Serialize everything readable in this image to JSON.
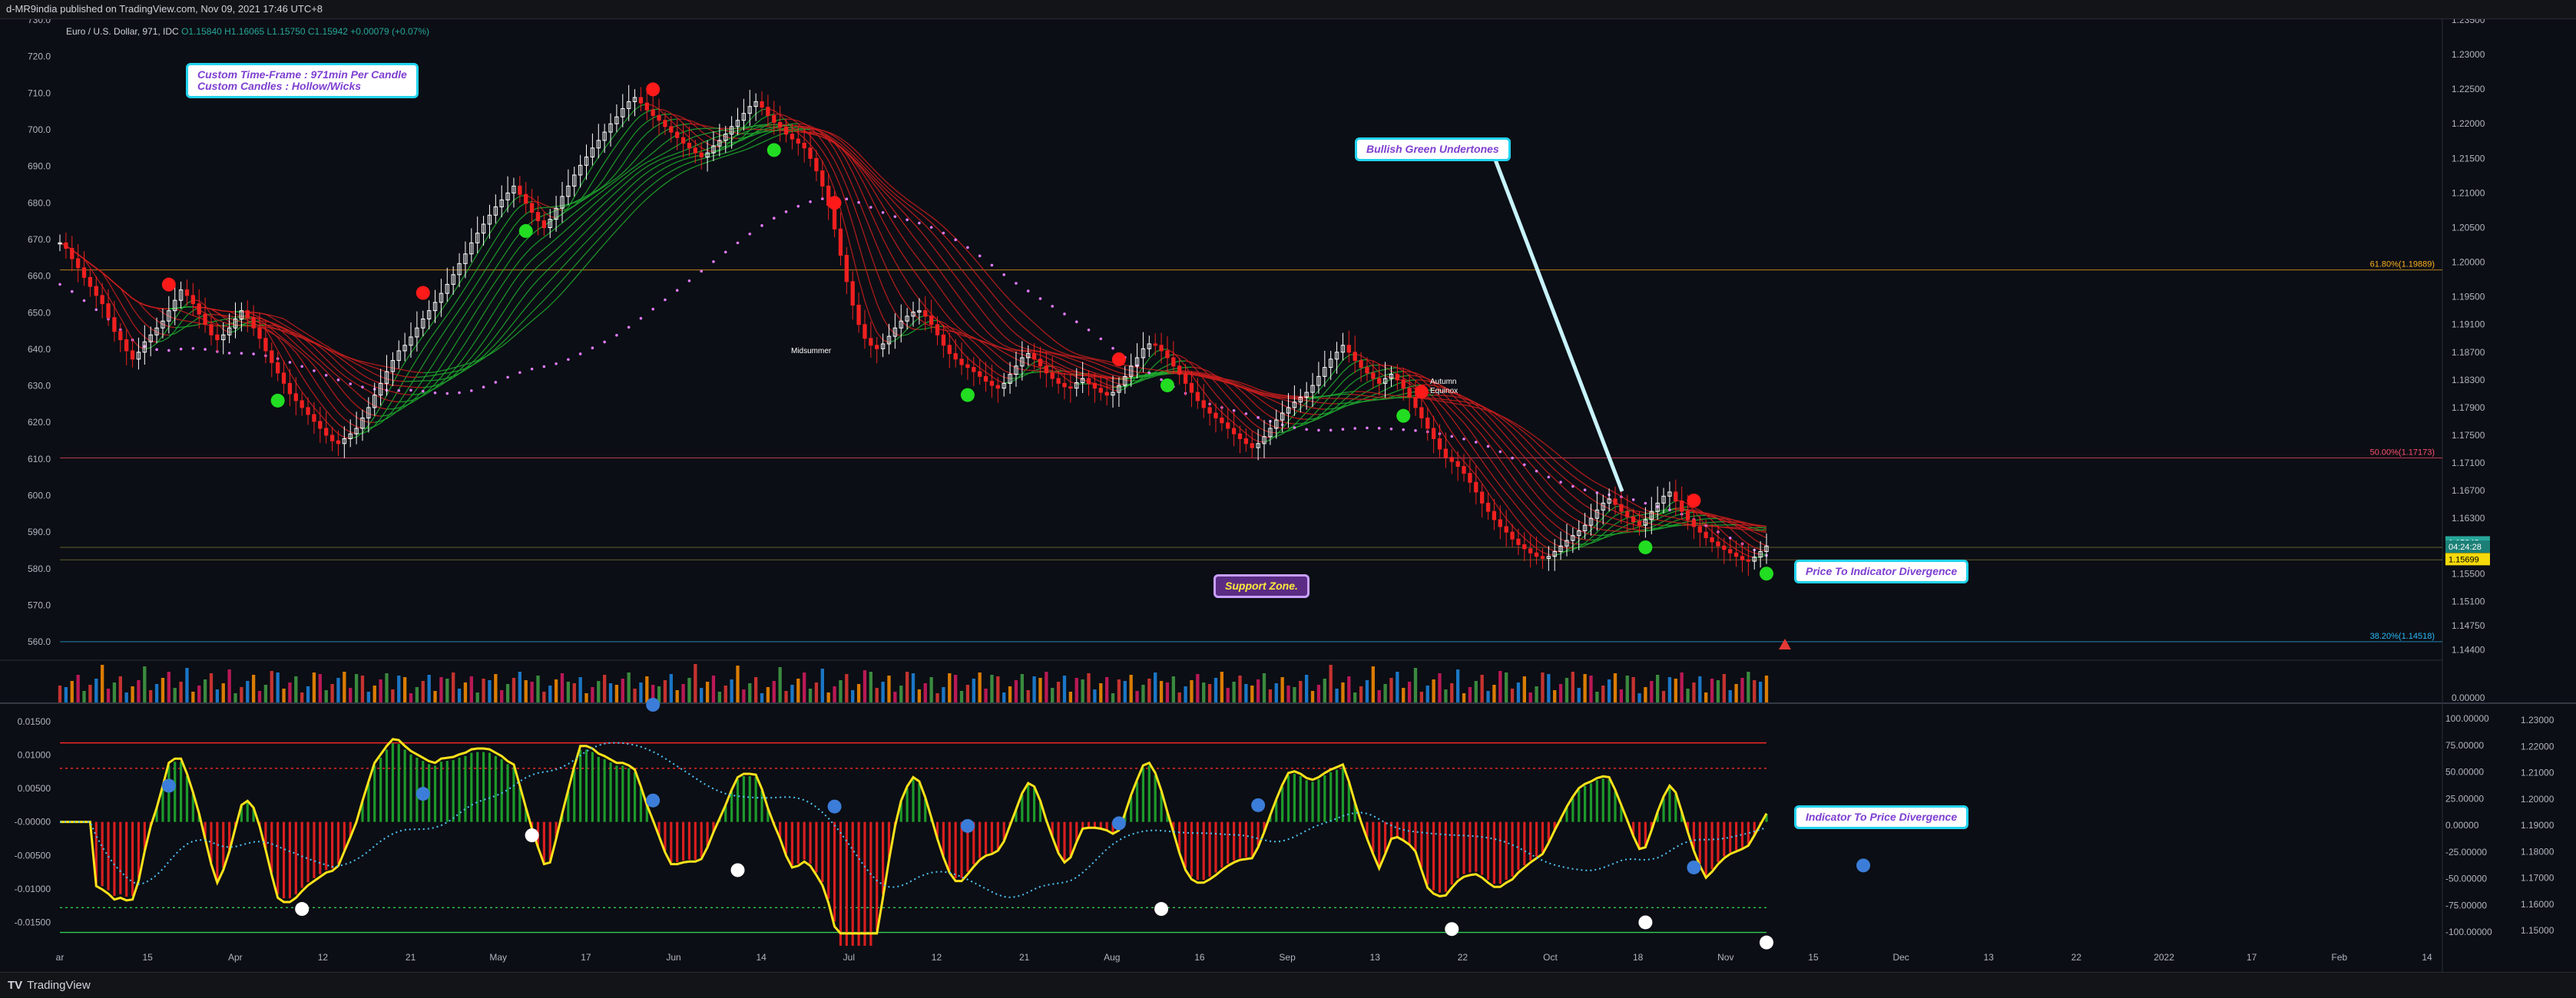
{
  "header": {
    "publish_line": "d-MR9india published on TradingView.com, Nov 09, 2021 17:46 UTC+8"
  },
  "legend": {
    "symbol": "Euro / U.S. Dollar, 971, IDC",
    "ohlc": "O1.15840 H1.16065 L1.15750 C1.15942 +0.00079 (+0.07%)"
  },
  "annotations": {
    "timeframe_line1": "Custom Time-Frame : 971min Per Candle",
    "timeframe_line2": "Custom Candles : Hollow/Wicks",
    "bullish": "Bullish Green Undertones",
    "support": "Support Zone.",
    "price_div": "Price To Indicator Divergence",
    "ind_div": "Indicator To Price Divergence",
    "lbl_main": "Midsummer",
    "lbl_autumn1": "Autumn",
    "lbl_autumn2": "Equinox"
  },
  "colors": {
    "background": "#0b0e14",
    "bull": "#ffffff",
    "bear": "#ef2020",
    "ribbon_red": "#c81e1e",
    "ribbon_green": "#1faa2e",
    "dots_red": "#ff1a1a",
    "dots_green": "#22dd22",
    "dots_blue": "#3b7dd8",
    "dots_white": "#ffffff",
    "oscillator": "#ffe21a",
    "cyan": "#4fc3f7",
    "magenta_dots": "#e27bff",
    "fib_618": "#ffb020",
    "fib_50": "#ff4f6d",
    "fib_382": "#29b6f6"
  },
  "footer": {
    "brand": "TradingView"
  },
  "chart_data": [
    {
      "type": "line",
      "title": "",
      "left_axis": {
        "range": [
          555.0,
          730.0
        ],
        "ticks": [
          "730.0",
          "720.0",
          "710.0",
          "700.0",
          "690.0",
          "680.0",
          "670.0",
          "660.0",
          "650.0",
          "640.0",
          "630.0",
          "620.0",
          "610.0",
          "600.0",
          "590.0",
          "580.0",
          "570.0",
          "560.0"
        ]
      },
      "right_axis": {
        "range": [
          1.1425,
          1.235
        ],
        "ticks": [
          "1.23500",
          "1.23000",
          "1.22500",
          "1.22000",
          "1.21500",
          "1.21000",
          "1.20500",
          "1.20000",
          "1.19500",
          "1.19100",
          "1.18700",
          "1.18300",
          "1.17900",
          "1.17500",
          "1.17100",
          "1.16700",
          "1.16300",
          "1.15900",
          "1.15500",
          "1.15100",
          "1.14750",
          "1.14400"
        ]
      },
      "x_ticks": [
        "ar",
        "15",
        "Apr",
        "12",
        "21",
        "May",
        "17",
        "Jun",
        "14",
        "Jul",
        "12",
        "21",
        "Aug",
        "16",
        "Sep",
        "13",
        "22",
        "Oct",
        "18",
        "Nov",
        "15",
        "Dec",
        "13",
        "22",
        "2022",
        "17",
        "Feb",
        "14"
      ],
      "fib_levels": [
        {
          "label": "61.80%(1.19889)",
          "value": 1.19889
        },
        {
          "label": "50.00%(1.17173)",
          "value": 1.17173
        },
        {
          "label": "38.20%(1.14518)",
          "value": 1.14518
        }
      ],
      "price_labels": [
        {
          "label": "1.15942",
          "value": 1.15942
        },
        {
          "label": "04:24:28",
          "value": 1.1588
        },
        {
          "label": "1.15699",
          "value": 1.15699
        }
      ],
      "close_series": [
        1.2028,
        1.202,
        1.2005,
        1.1992,
        1.1978,
        1.1965,
        1.1952,
        1.194,
        1.192,
        1.19,
        1.1888,
        1.1872,
        1.186,
        1.187,
        1.1885,
        1.1895,
        1.1905,
        1.1915,
        1.193,
        1.1945,
        1.196,
        1.1952,
        1.194,
        1.1925,
        1.191,
        1.1895,
        1.1888,
        1.1895,
        1.1905,
        1.1918,
        1.193,
        1.192,
        1.1905,
        1.189,
        1.1872,
        1.1855,
        1.184,
        1.1825,
        1.181,
        1.18,
        1.179,
        1.178,
        1.177,
        1.176,
        1.175,
        1.1742,
        1.1738,
        1.1745,
        1.1752,
        1.176,
        1.1775,
        1.179,
        1.1808,
        1.1825,
        1.1842,
        1.1858,
        1.1872,
        1.188,
        1.1892,
        1.1905,
        1.1918,
        1.193,
        1.1942,
        1.1955,
        1.1968,
        1.1982,
        1.1998,
        1.2012,
        1.2028,
        1.2042,
        1.2055,
        1.2068,
        1.208,
        1.209,
        1.21,
        1.211,
        1.2098,
        1.2085,
        1.2072,
        1.206,
        1.205,
        1.2062,
        1.2078,
        1.2095,
        1.211,
        1.2126,
        1.214,
        1.2152,
        1.2165,
        1.2176,
        1.2188,
        1.22,
        1.221,
        1.2222,
        1.2232,
        1.2238,
        1.223,
        1.222,
        1.2212,
        1.2205,
        1.2196,
        1.2188,
        1.218,
        1.2172,
        1.2165,
        1.2158,
        1.2152,
        1.2158,
        1.2168,
        1.2176,
        1.2185,
        1.2196,
        1.2205,
        1.2215,
        1.2225,
        1.2232,
        1.2224,
        1.2212,
        1.2202,
        1.2195,
        1.2185,
        1.2178,
        1.2172,
        1.2165,
        1.215,
        1.2132,
        1.211,
        1.2082,
        1.2048,
        1.201,
        1.1972,
        1.1938,
        1.191,
        1.189,
        1.188,
        1.1875,
        1.1882,
        1.1893,
        1.1905,
        1.1915,
        1.1922,
        1.1928,
        1.193,
        1.1922,
        1.191,
        1.1895,
        1.188,
        1.1868,
        1.186,
        1.1852,
        1.1848,
        1.1842,
        1.1835,
        1.1828,
        1.1822,
        1.1818,
        1.1825,
        1.1838,
        1.185,
        1.1862,
        1.1868,
        1.186,
        1.185,
        1.184,
        1.1832,
        1.1825,
        1.182,
        1.1818,
        1.1826,
        1.1832,
        1.1825,
        1.1818,
        1.1812,
        1.1808,
        1.1812,
        1.1822,
        1.1835,
        1.185,
        1.1862,
        1.1875,
        1.1882,
        1.188,
        1.1872,
        1.1862,
        1.185,
        1.1838,
        1.1825,
        1.1812,
        1.18,
        1.179,
        1.1782,
        1.1775,
        1.1768,
        1.176,
        1.1752,
        1.1745,
        1.1738,
        1.1732,
        1.1738,
        1.1748,
        1.176,
        1.1772,
        1.1782,
        1.179,
        1.1798,
        1.1805,
        1.1812,
        1.1822,
        1.1835,
        1.1848,
        1.186,
        1.187,
        1.188,
        1.187,
        1.1858,
        1.1848,
        1.184,
        1.1832,
        1.1825,
        1.1832,
        1.1838,
        1.183,
        1.1818,
        1.1805,
        1.179,
        1.1775,
        1.176,
        1.1745,
        1.173,
        1.1718,
        1.1712,
        1.1705,
        1.1695,
        1.1682,
        1.1668,
        1.1652,
        1.164,
        1.1628,
        1.1618,
        1.161,
        1.16,
        1.1592,
        1.1586,
        1.158,
        1.1575,
        1.1572,
        1.1575,
        1.1582,
        1.159,
        1.1598,
        1.1605,
        1.1612,
        1.162,
        1.163,
        1.1642,
        1.1652,
        1.1658,
        1.165,
        1.164,
        1.1632,
        1.1625,
        1.162,
        1.1628,
        1.164,
        1.1652,
        1.1662,
        1.1668,
        1.1655,
        1.164,
        1.1628,
        1.1618,
        1.161,
        1.1602,
        1.1596,
        1.159,
        1.1585,
        1.158,
        1.1575,
        1.157,
        1.1568,
        1.1574,
        1.1582,
        1.159
      ],
      "series": [
        {
          "name": "",
          "values": "close_series"
        }
      ]
    },
    {
      "type": "line",
      "title": "",
      "left_axis": {
        "range": [
          -0.0185,
          0.0175
        ],
        "ticks": [
          "0.01500",
          "0.01000",
          "0.00500",
          "-0.00000",
          "-0.00500",
          "-0.01000",
          "-0.01500"
        ]
      },
      "right_axis_1": {
        "range": [
          -115,
          115
        ],
        "ticks": [
          "100.00000",
          "75.00000",
          "50.00000",
          "25.00000",
          "0.00000",
          "-25.00000",
          "-50.00000",
          "-75.00000",
          "-100.00000"
        ]
      },
      "right_axis_2": {
        "ticks": [
          "1.23000",
          "1.22000",
          "1.21000",
          "1.20000",
          "1.19000",
          "1.18000",
          "1.17000",
          "1.16000",
          "1.15000"
        ]
      },
      "levels": [
        {
          "label": "upper",
          "value": 0.0118
        },
        {
          "label": "upper-dotted",
          "value": 0.008
        },
        {
          "label": "lower-dotted",
          "value": -0.0128
        },
        {
          "label": "lower",
          "value": -0.0165
        }
      ]
    }
  ]
}
